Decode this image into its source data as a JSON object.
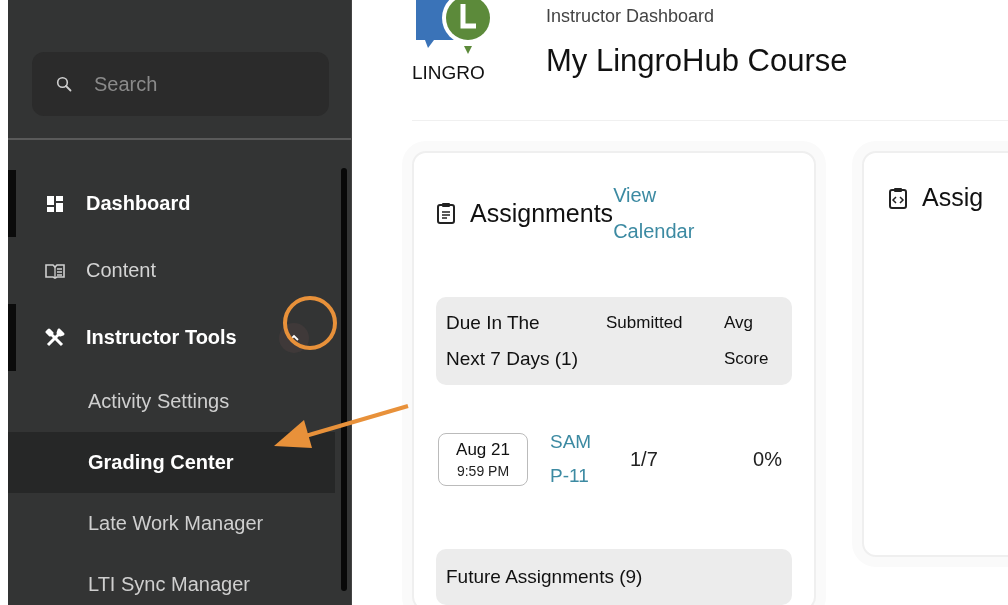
{
  "sidebar": {
    "search": {
      "placeholder": "Search"
    },
    "items": [
      {
        "kind": "dashboard",
        "label": "Dashboard",
        "selected": true
      },
      {
        "kind": "content",
        "label": "Content",
        "selected": false
      },
      {
        "kind": "tools",
        "label": "Instructor Tools",
        "selected": true,
        "expanded": true,
        "children": [
          {
            "label": "Activity Settings",
            "selected": false
          },
          {
            "label": "Grading Center",
            "selected": true
          },
          {
            "label": "Late Work Manager",
            "selected": false
          },
          {
            "label": "LTI Sync Manager",
            "selected": false
          }
        ]
      }
    ]
  },
  "header": {
    "logo_text": "LINGRO",
    "subtitle": "Instructor Dashboard",
    "title": "My LingroHub Course"
  },
  "assignments_card": {
    "title": "Assignments",
    "link": [
      "View",
      "Calendar"
    ],
    "due_section": {
      "heading": [
        "Due In The",
        "Next 7 Days (1)"
      ],
      "columns": [
        "Submitted",
        [
          "Avg",
          "Score"
        ]
      ],
      "rows": [
        {
          "date": "Aug 21",
          "time": "9:59 PM",
          "name": [
            "SAM",
            "P-11"
          ],
          "submitted": "1/7",
          "avg_score": "0%"
        }
      ]
    },
    "future_section": {
      "heading": "Future Assignments (9)"
    }
  },
  "second_card": {
    "title": "Assig"
  }
}
